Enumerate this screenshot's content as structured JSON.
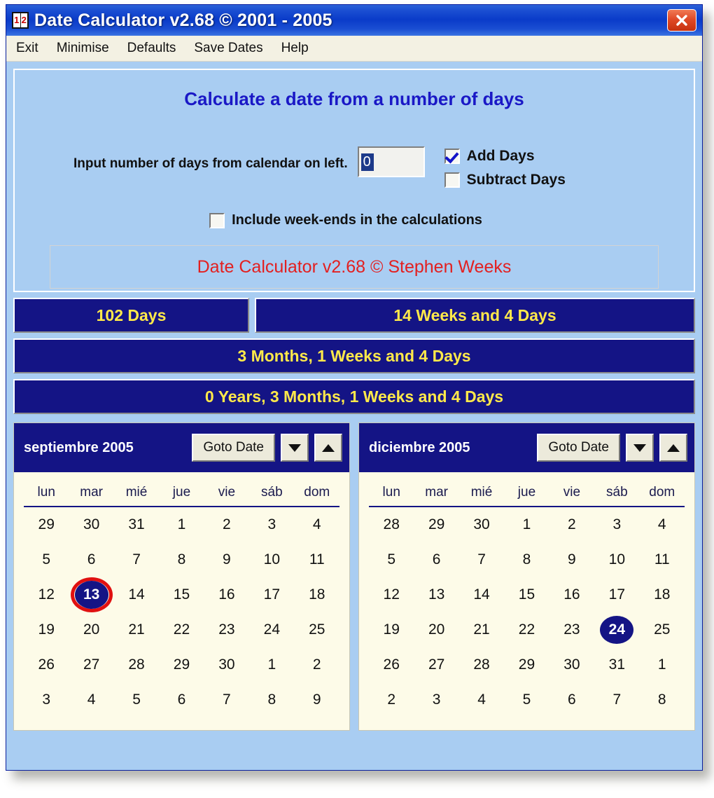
{
  "window": {
    "title": "Date Calculator v2.68 © 2001 - 2005",
    "icon": "calendar-12-icon",
    "close_label": "close-icon",
    "accent_navy": "#141485",
    "accent_blue_panel": "#a9cdf2",
    "accent_yellow": "#ffe94a",
    "accent_red": "#e32020",
    "calendar_bg": "#fdfbe8"
  },
  "menu": {
    "items": [
      {
        "label": "Exit",
        "name": "menu-item-exit"
      },
      {
        "label": "Minimise",
        "name": "menu-item-minimise"
      },
      {
        "label": "Defaults",
        "name": "menu-item-defaults"
      },
      {
        "label": "Save Dates",
        "name": "menu-item-save-dates"
      },
      {
        "label": "Help",
        "name": "menu-item-help"
      }
    ]
  },
  "panel": {
    "heading": "Calculate a date from a number of days",
    "input_label": "Input number of days from calendar on left.",
    "days_value": "0",
    "days_placeholder": "0",
    "add_days_label": "Add Days",
    "add_days_checked": true,
    "subtract_days_label": "Subtract Days",
    "subtract_days_checked": false,
    "weekends_label": "Include week-ends in the calculations",
    "weekends_checked": false,
    "credit": "Date Calculator v2.68 © Stephen Weeks"
  },
  "results": {
    "days": "102 Days",
    "weeks": "14 Weeks and 4 Days",
    "months": "3 Months, 1 Weeks and 4 Days",
    "years": "0 Years, 3 Months, 1 Weeks and 4 Days"
  },
  "calendars": [
    {
      "id": "calendar-left",
      "month_label": "septiembre 2005",
      "goto_label": "Goto Date",
      "down_label": "chevron-down-icon",
      "up_label": "chevron-up-icon",
      "weekdays": [
        "lun",
        "mar",
        "mié",
        "jue",
        "vie",
        "sáb",
        "dom"
      ],
      "weeks": [
        [
          {
            "d": "29",
            "t": "other"
          },
          {
            "d": "30",
            "t": "other"
          },
          {
            "d": "31",
            "t": "other"
          },
          {
            "d": "1",
            "t": "cur"
          },
          {
            "d": "2",
            "t": "cur"
          },
          {
            "d": "3",
            "t": "wknd"
          },
          {
            "d": "4",
            "t": "wknd"
          }
        ],
        [
          {
            "d": "5",
            "t": "cur"
          },
          {
            "d": "6",
            "t": "cur"
          },
          {
            "d": "7",
            "t": "cur"
          },
          {
            "d": "8",
            "t": "cur"
          },
          {
            "d": "9",
            "t": "cur"
          },
          {
            "d": "10",
            "t": "wknd"
          },
          {
            "d": "11",
            "t": "wknd"
          }
        ],
        [
          {
            "d": "12",
            "t": "cur"
          },
          {
            "d": "13",
            "t": "cur",
            "sel": true,
            "ring": true
          },
          {
            "d": "14",
            "t": "cur"
          },
          {
            "d": "15",
            "t": "cur"
          },
          {
            "d": "16",
            "t": "cur"
          },
          {
            "d": "17",
            "t": "wknd"
          },
          {
            "d": "18",
            "t": "wknd"
          }
        ],
        [
          {
            "d": "19",
            "t": "cur"
          },
          {
            "d": "20",
            "t": "cur"
          },
          {
            "d": "21",
            "t": "cur"
          },
          {
            "d": "22",
            "t": "cur"
          },
          {
            "d": "23",
            "t": "cur"
          },
          {
            "d": "24",
            "t": "wknd"
          },
          {
            "d": "25",
            "t": "wknd"
          }
        ],
        [
          {
            "d": "26",
            "t": "cur"
          },
          {
            "d": "27",
            "t": "cur"
          },
          {
            "d": "28",
            "t": "cur"
          },
          {
            "d": "29",
            "t": "cur"
          },
          {
            "d": "30",
            "t": "cur"
          },
          {
            "d": "1",
            "t": "other"
          },
          {
            "d": "2",
            "t": "other"
          }
        ],
        [
          {
            "d": "3",
            "t": "other"
          },
          {
            "d": "4",
            "t": "other"
          },
          {
            "d": "5",
            "t": "other"
          },
          {
            "d": "6",
            "t": "other"
          },
          {
            "d": "7",
            "t": "other"
          },
          {
            "d": "8",
            "t": "other"
          },
          {
            "d": "9",
            "t": "other"
          }
        ]
      ]
    },
    {
      "id": "calendar-right",
      "month_label": "diciembre 2005",
      "goto_label": "Goto Date",
      "down_label": "chevron-down-icon",
      "up_label": "chevron-up-icon",
      "weekdays": [
        "lun",
        "mar",
        "mié",
        "jue",
        "vie",
        "sáb",
        "dom"
      ],
      "weeks": [
        [
          {
            "d": "28",
            "t": "other"
          },
          {
            "d": "29",
            "t": "other"
          },
          {
            "d": "30",
            "t": "other"
          },
          {
            "d": "1",
            "t": "cur"
          },
          {
            "d": "2",
            "t": "cur"
          },
          {
            "d": "3",
            "t": "wknd"
          },
          {
            "d": "4",
            "t": "wknd"
          }
        ],
        [
          {
            "d": "5",
            "t": "cur"
          },
          {
            "d": "6",
            "t": "cur"
          },
          {
            "d": "7",
            "t": "cur"
          },
          {
            "d": "8",
            "t": "cur"
          },
          {
            "d": "9",
            "t": "cur"
          },
          {
            "d": "10",
            "t": "wknd"
          },
          {
            "d": "11",
            "t": "wknd"
          }
        ],
        [
          {
            "d": "12",
            "t": "cur"
          },
          {
            "d": "13",
            "t": "cur"
          },
          {
            "d": "14",
            "t": "cur"
          },
          {
            "d": "15",
            "t": "cur"
          },
          {
            "d": "16",
            "t": "cur"
          },
          {
            "d": "17",
            "t": "wknd"
          },
          {
            "d": "18",
            "t": "wknd"
          }
        ],
        [
          {
            "d": "19",
            "t": "cur"
          },
          {
            "d": "20",
            "t": "cur"
          },
          {
            "d": "21",
            "t": "cur"
          },
          {
            "d": "22",
            "t": "cur"
          },
          {
            "d": "23",
            "t": "cur"
          },
          {
            "d": "24",
            "t": "wknd",
            "sel": true
          },
          {
            "d": "25",
            "t": "wknd"
          }
        ],
        [
          {
            "d": "26",
            "t": "cur"
          },
          {
            "d": "27",
            "t": "cur"
          },
          {
            "d": "28",
            "t": "cur"
          },
          {
            "d": "29",
            "t": "cur"
          },
          {
            "d": "30",
            "t": "cur"
          },
          {
            "d": "31",
            "t": "wknd"
          },
          {
            "d": "1",
            "t": "other"
          }
        ],
        [
          {
            "d": "2",
            "t": "other"
          },
          {
            "d": "3",
            "t": "other"
          },
          {
            "d": "4",
            "t": "other"
          },
          {
            "d": "5",
            "t": "other"
          },
          {
            "d": "6",
            "t": "other"
          },
          {
            "d": "7",
            "t": "other"
          },
          {
            "d": "8",
            "t": "other"
          }
        ]
      ]
    }
  ]
}
